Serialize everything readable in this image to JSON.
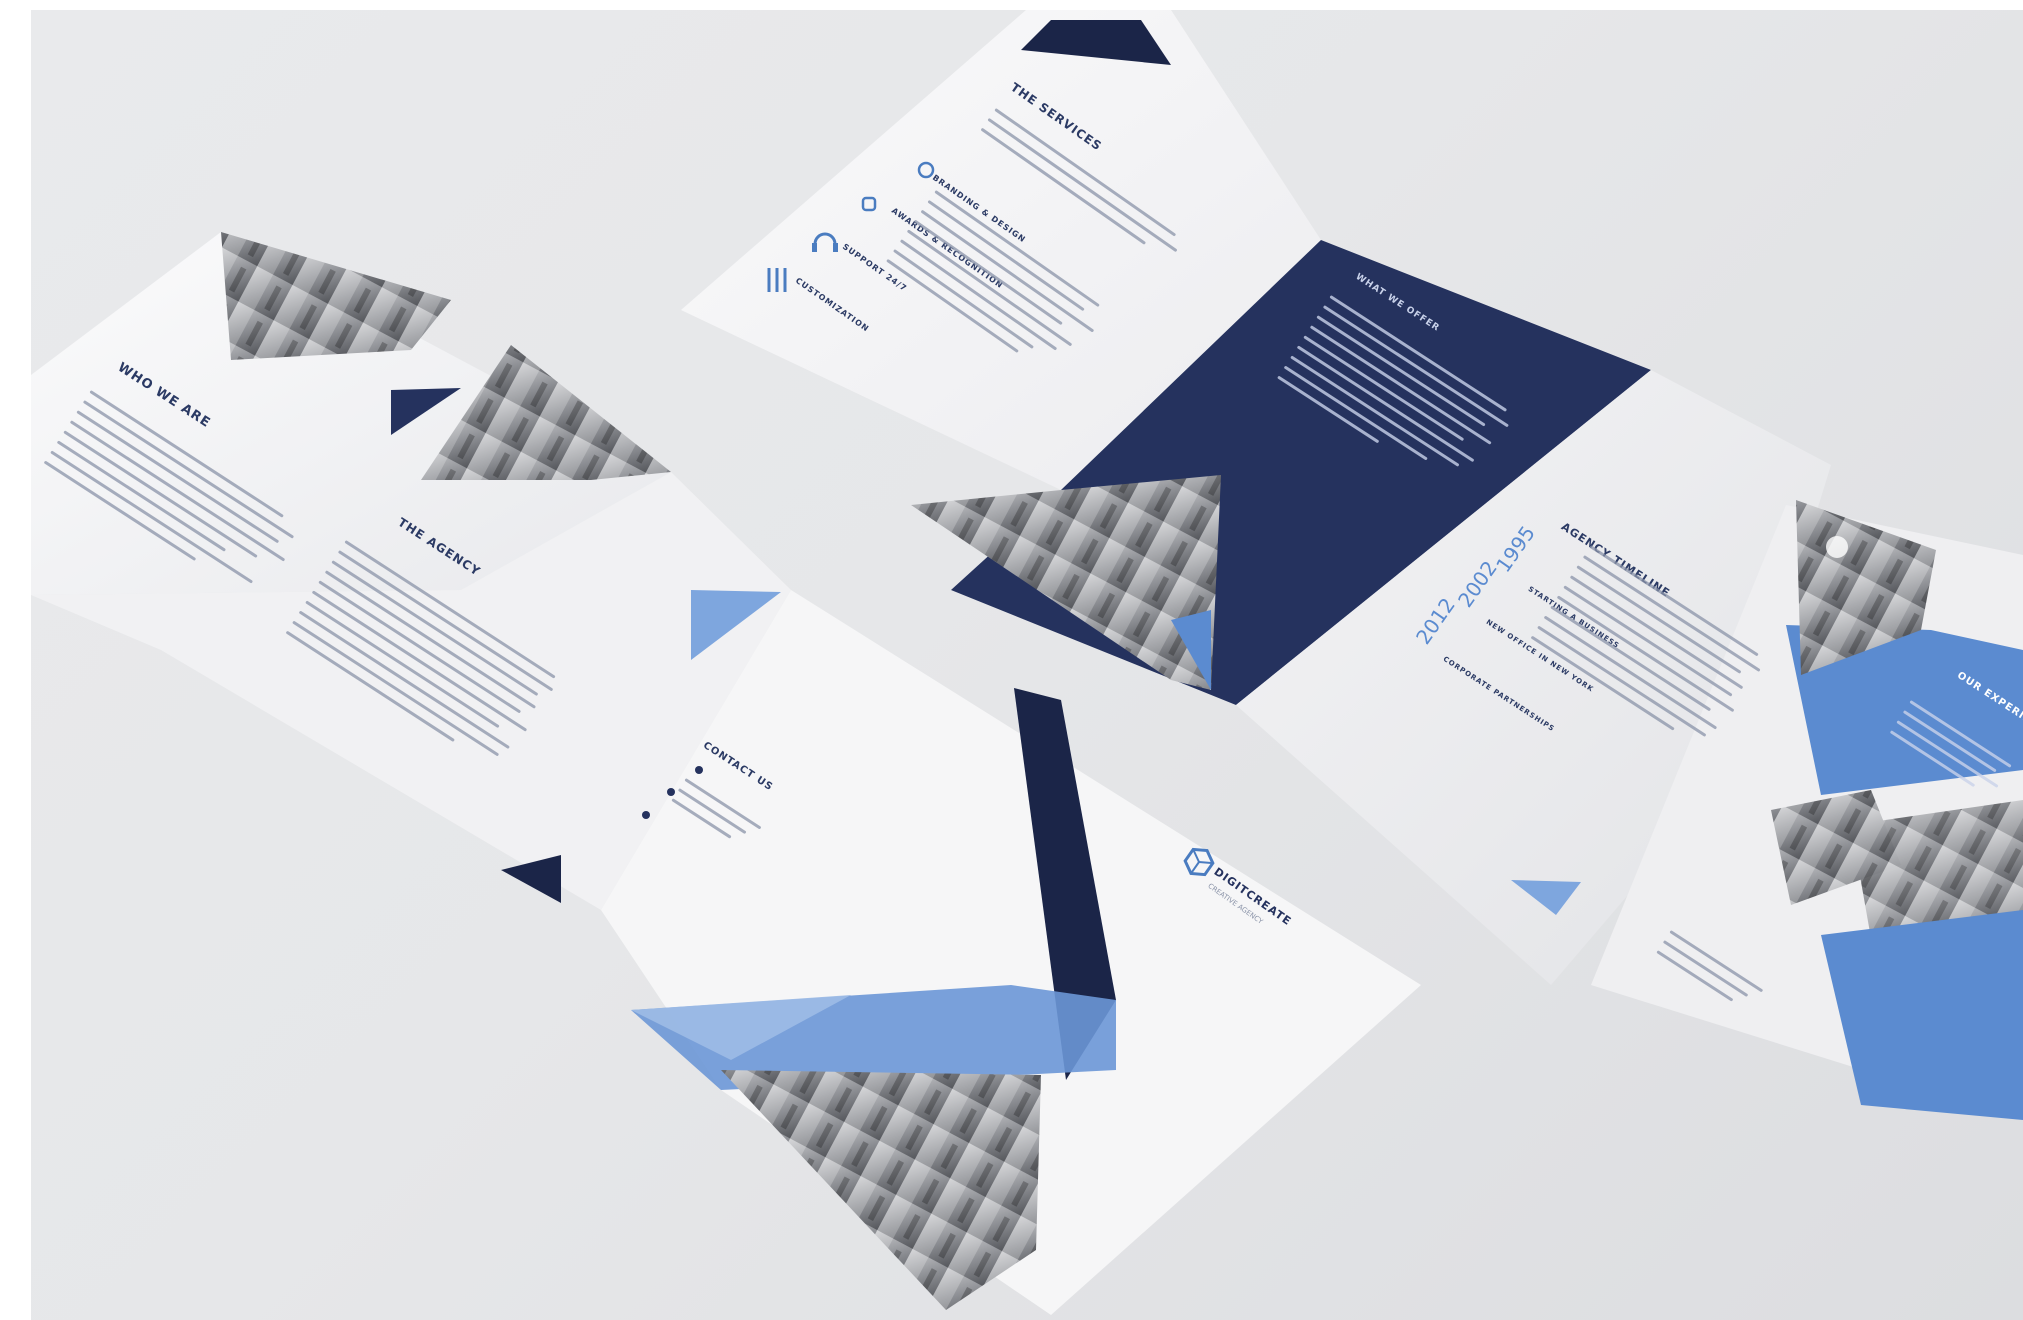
{
  "left_brochure": {
    "panel_1_heading": "WHO WE ARE",
    "panel_2_heading": "THE AGENCY",
    "contact_heading": "CONTACT US",
    "logo_brand": "DIGITCREATE",
    "logo_tagline": "CREATIVE AGENCY"
  },
  "right_brochure": {
    "services_heading": "THE SERVICES",
    "service_items": [
      "BRANDING & DESIGN",
      "AWARDS & RECOGNITION",
      "SUPPORT 24/7",
      "CUSTOMIZATION"
    ],
    "offer_heading": "WHAT WE OFFER",
    "timeline_heading": "AGENCY TIMELINE",
    "timeline_years": [
      "1995",
      "2002",
      "2012"
    ],
    "timeline_items": [
      "STARTING A BUSINESS",
      "NEW OFFICE IN NEW YORK",
      "CORPORATE PARTNERSHIPS"
    ],
    "experience_heading": "OUR EXPERIENCE"
  },
  "colors": {
    "navy": "#25325e",
    "dark_navy": "#1b2548",
    "accent_blue": "#5b8bd0",
    "light_blue": "#7ea6de",
    "paper": "#f7f7f8",
    "background": "#e6e7e9"
  }
}
